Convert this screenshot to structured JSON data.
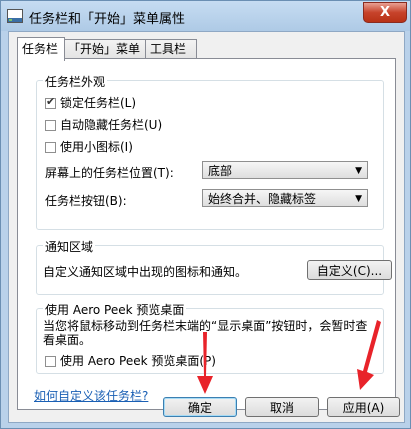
{
  "window": {
    "title": "任务栏和「开始」菜单属性",
    "close_label": "X"
  },
  "tabs": [
    {
      "label": "任务栏",
      "active": true
    },
    {
      "label": "「开始」菜单",
      "active": false
    },
    {
      "label": "工具栏",
      "active": false
    }
  ],
  "appearance": {
    "title": "任务栏外观",
    "lock": {
      "label": "锁定任务栏(L)",
      "checked": true
    },
    "autohide": {
      "label": "自动隐藏任务栏(U)",
      "checked": false
    },
    "small_icons": {
      "label": "使用小图标(I)",
      "checked": false
    },
    "location": {
      "label": "屏幕上的任务栏位置(T):",
      "value": "底部"
    },
    "buttons": {
      "label": "任务栏按钮(B):",
      "value": "始终合并、隐藏标签"
    }
  },
  "notify": {
    "title": "通知区域",
    "desc": "自定义通知区域中出现的图标和通知。",
    "customize_label": "自定义(C)..."
  },
  "aero": {
    "title": "使用 Aero Peek 预览桌面",
    "desc": "当您将鼠标移动到任务栏末端的“显示桌面”按钮时，会暂时查看桌面。",
    "checkbox": {
      "label": "使用 Aero Peek 预览桌面(P)",
      "checked": false
    }
  },
  "help_link": "如何自定义该任务栏?",
  "footer": {
    "ok_label": "确定",
    "cancel_label": "取消",
    "apply_label": "应用(A)"
  },
  "colors": {
    "annotation_arrow": "#e8232a",
    "link": "#1a5fb4"
  }
}
